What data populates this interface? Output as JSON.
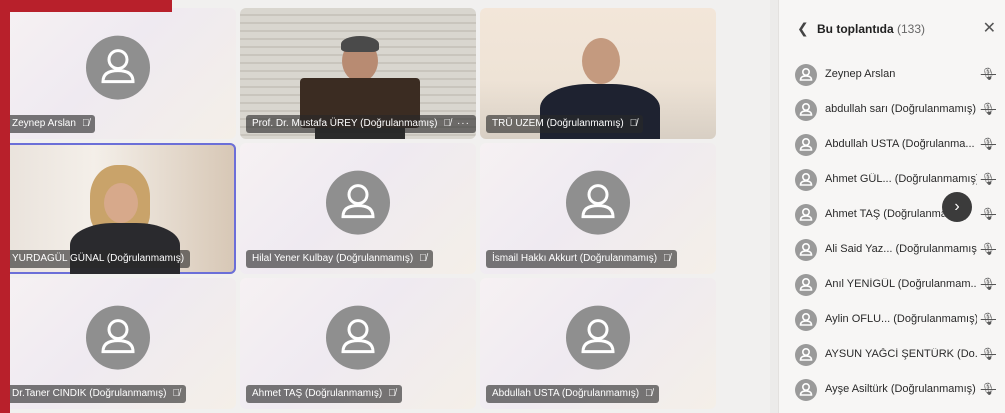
{
  "tiles": [
    {
      "name": "Zeynep Arslan",
      "mic": "🎙̸"
    },
    {
      "name": "Prof. Dr. Mustafa ÜREY (Doğrulanmamış)",
      "mic": "🎙̸",
      "more": "···"
    },
    {
      "name": "TRÜ UZEM (Doğrulanmamış)",
      "mic": "🎙̸"
    },
    {
      "name": "YURDAGÜL GÜNAL (Doğrulanmamış)"
    },
    {
      "name": "Hilal Yener Kulbay (Doğrulanmamış)",
      "mic": "🎙̸"
    },
    {
      "name": "İsmail Hakkı Akkurt (Doğrulanmamış)",
      "mic": "🎙̸"
    },
    {
      "name": "Dr.Taner CINDIK (Doğrulanmamış)",
      "mic": "🎙̸"
    },
    {
      "name": "Ahmet TAŞ (Doğrulanmamış)",
      "mic": "🎙̸"
    },
    {
      "name": "Abdullah USTA (Doğrulanmamış)",
      "mic": "🎙̸"
    }
  ],
  "panel": {
    "title": "Bu toplantıda",
    "count": "(133)",
    "participants": [
      "Zeynep Arslan",
      "abdullah sarı (Doğrulanmamış)",
      "Abdullah USTA (Doğrulanma...",
      "Ahmet GÜL... (Doğrulanmamış)",
      "Ahmet TAŞ (Doğrulanmamış)",
      "Ali Said Yaz... (Doğrulanmamış)",
      "Anıl YENİGÜL (Doğrulanmam...",
      "Aylin OFLU... (Doğrulanmamış)",
      "AYSUN YAĞCİ ŞENTÜRK (Do...",
      "Ayşe Asiltürk (Doğrulanmamış)"
    ]
  }
}
